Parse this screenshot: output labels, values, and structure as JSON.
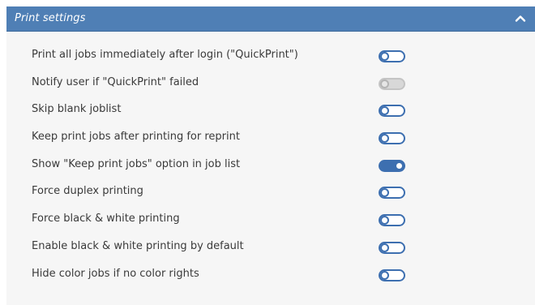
{
  "panel": {
    "title": "Print settings",
    "collapse_icon": "chevron-up-icon"
  },
  "settings": [
    {
      "label": "Print all jobs immediately after login (\"QuickPrint\")",
      "state": "off"
    },
    {
      "label": "Notify user if \"QuickPrint\" failed",
      "state": "disabled"
    },
    {
      "label": "Skip blank joblist",
      "state": "off"
    },
    {
      "label": "Keep print jobs after printing for reprint",
      "state": "off"
    },
    {
      "label": "Show \"Keep print jobs\" option in job list",
      "state": "on"
    },
    {
      "label": "Force duplex printing",
      "state": "off"
    },
    {
      "label": "Force black & white printing",
      "state": "off"
    },
    {
      "label": "Enable black & white printing by default",
      "state": "off"
    },
    {
      "label": "Hide color jobs if no color rights",
      "state": "off"
    }
  ],
  "colors": {
    "header": "#4f7fb5",
    "toggle_accent": "#3d6fb0",
    "disabled": "#c4c4c4"
  }
}
